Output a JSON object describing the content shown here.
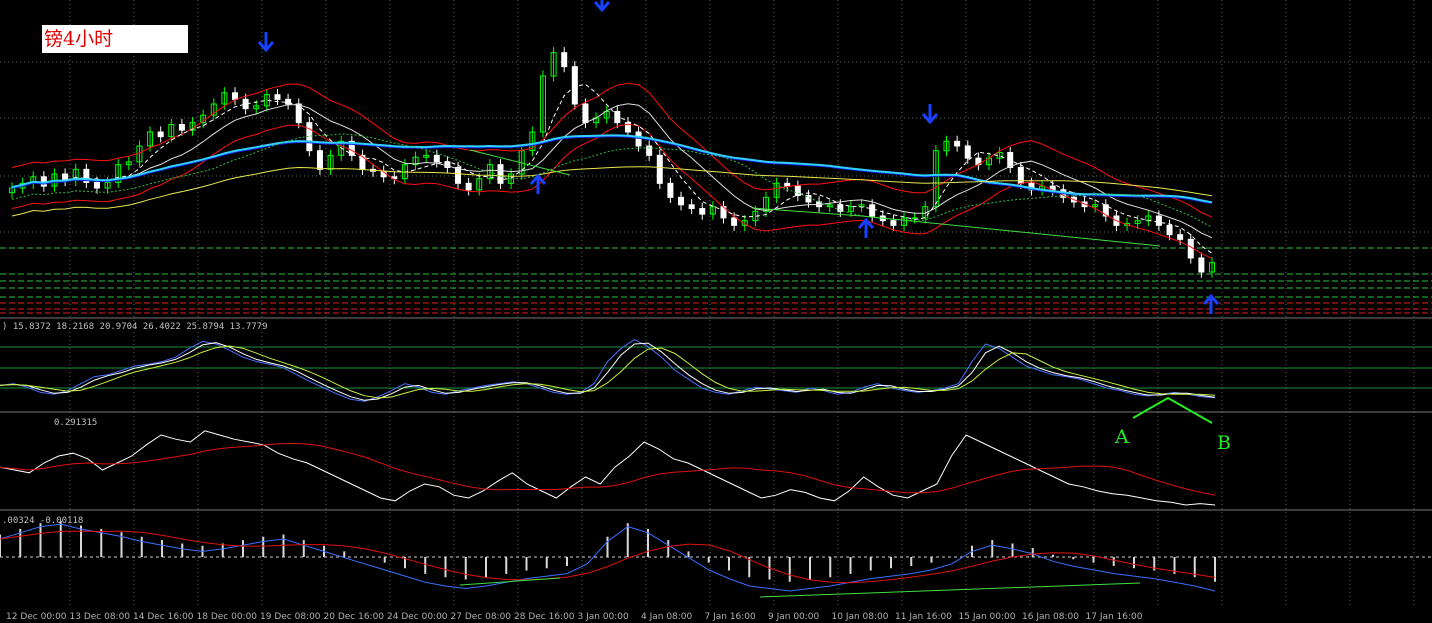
{
  "window": {
    "title": "镑4小时"
  },
  "indicators": {
    "stoch_label": ") 15.8372 18.2168 20.9704 26.4022 25.8794 13.7779",
    "rsi_label": "0.291315",
    "macd_label": ".00324 -0.00118"
  },
  "annotations": {
    "a": "A",
    "b": "B"
  },
  "x_labels": [
    "12 Dec 00:00",
    "13 Dec 08:00",
    "14 Dec 16:00",
    "18 Dec 00:00",
    "19 Dec 08:00",
    "20 Dec 16:00",
    "24 Dec 00:00",
    "27 Dec 08:00",
    "28 Dec 16:00",
    "3 Jan 00:00",
    "4 Jan 08:00",
    "7 Jan 16:00",
    "9 Jan 00:00",
    "10 Jan 08:00",
    "11 Jan 16:00",
    "15 Jan 00:00",
    "16 Jan 08:00",
    "17 Jan 16:00"
  ],
  "colors": {
    "up": "#00ff00",
    "down": "#ffffff",
    "band": "#ff1010",
    "ma_blue": "#1020e0",
    "ma_cyan": "#30d0ff",
    "ma_yellow": "#e8e850",
    "grid": "#5a6a5a"
  },
  "chart_data": {
    "type": "candlestick",
    "title": "镑4小时",
    "close": [
      1.27,
      1.2705,
      1.2712,
      1.2702,
      1.2715,
      1.2708,
      1.272,
      1.2706,
      1.27,
      1.2706,
      1.2725,
      1.2728,
      1.2745,
      1.276,
      1.2755,
      1.2768,
      1.2762,
      1.277,
      1.2778,
      1.279,
      1.2802,
      1.2795,
      1.2785,
      1.2788,
      1.28,
      1.2795,
      1.279,
      1.277,
      1.274,
      1.272,
      1.2735,
      1.275,
      1.2735,
      1.272,
      1.2718,
      1.2712,
      1.271,
      1.2725,
      1.2733,
      1.2735,
      1.2728,
      1.2722,
      1.2705,
      1.2698,
      1.271,
      1.2725,
      1.2705,
      1.2715,
      1.274,
      1.276,
      1.282,
      1.2845,
      1.283,
      1.279,
      1.277,
      1.2775,
      1.2782,
      1.277,
      1.276,
      1.2745,
      1.2735,
      1.2705,
      1.269,
      1.2682,
      1.2678,
      1.2672,
      1.268,
      1.2668,
      1.266,
      1.2665,
      1.2675,
      1.269,
      1.2705,
      1.2702,
      1.2692,
      1.2685,
      1.268,
      1.2682,
      1.2675,
      1.268,
      1.2682,
      1.267,
      1.2665,
      1.266,
      1.2668,
      1.2668,
      1.268,
      1.274,
      1.275,
      1.2745,
      1.2732,
      1.2725,
      1.2732,
      1.2738,
      1.2722,
      1.2705,
      1.2698,
      1.2702,
      1.2698,
      1.269,
      1.2685,
      1.268,
      1.2682,
      1.267,
      1.266,
      1.2662,
      1.2665,
      1.267,
      1.266,
      1.265,
      1.2645,
      1.2625,
      1.261,
      1.262
    ],
    "series": [
      {
        "name": "Stochastic",
        "values": [
          28,
          30,
          26,
          20,
          18,
          22,
          30,
          38,
          40,
          45,
          50,
          52,
          55,
          60,
          70,
          78,
          75,
          68,
          60,
          55,
          52,
          48,
          40,
          32,
          25,
          18,
          12,
          10,
          15,
          22,
          30,
          26,
          20,
          18,
          22,
          25,
          28,
          30,
          32,
          30,
          25,
          20,
          18,
          20,
          30,
          55,
          70,
          80,
          72,
          60,
          45,
          35,
          25,
          20,
          18,
          22,
          26,
          24,
          22,
          20,
          25,
          22,
          18,
          20,
          26,
          30,
          25,
          22,
          20,
          22,
          25,
          30,
          55,
          75,
          70,
          60,
          50,
          45,
          40,
          38,
          35,
          30,
          25,
          22,
          18,
          16,
          18,
          20,
          18,
          15,
          14
        ]
      },
      {
        "name": "RSI",
        "values": [
          52,
          50,
          48,
          55,
          60,
          62,
          58,
          50,
          55,
          60,
          68,
          75,
          72,
          70,
          78,
          75,
          72,
          70,
          68,
          62,
          58,
          55,
          50,
          45,
          40,
          35,
          30,
          28,
          35,
          40,
          38,
          32,
          30,
          35,
          42,
          48,
          40,
          35,
          30,
          38,
          45,
          40,
          52,
          60,
          70,
          65,
          58,
          55,
          50,
          45,
          40,
          35,
          30,
          32,
          36,
          34,
          30,
          28,
          35,
          45,
          38,
          32,
          30,
          35,
          40,
          60,
          75,
          70,
          65,
          60,
          55,
          50,
          45,
          40,
          38,
          35,
          33,
          32,
          30,
          28,
          27,
          25,
          26,
          25
        ]
      },
      {
        "name": "MACD",
        "values": [
          0.002,
          0.0025,
          0.003,
          0.0032,
          0.0028,
          0.0025,
          0.0022,
          0.0018,
          0.0015,
          0.0012,
          0.001,
          0.0012,
          0.0015,
          0.0018,
          0.002,
          0.0015,
          0.001,
          0.0005,
          0.0,
          -0.0005,
          -0.001,
          -0.0015,
          -0.0018,
          -0.002,
          -0.0018,
          -0.0015,
          -0.0012,
          -0.001,
          -0.0008,
          0.0,
          0.0018,
          0.003,
          0.0025,
          0.0015,
          0.0005,
          -0.0005,
          -0.0012,
          -0.0018,
          -0.002,
          -0.0022,
          -0.002,
          -0.0018,
          -0.0015,
          -0.0012,
          -0.001,
          -0.0008,
          -0.0005,
          0.0,
          0.001,
          0.0015,
          0.0012,
          0.0008,
          0.0002,
          -0.0002,
          -0.0005,
          -0.0008,
          -0.001,
          -0.0012,
          -0.0015,
          -0.0018,
          -0.0022
        ]
      }
    ]
  }
}
